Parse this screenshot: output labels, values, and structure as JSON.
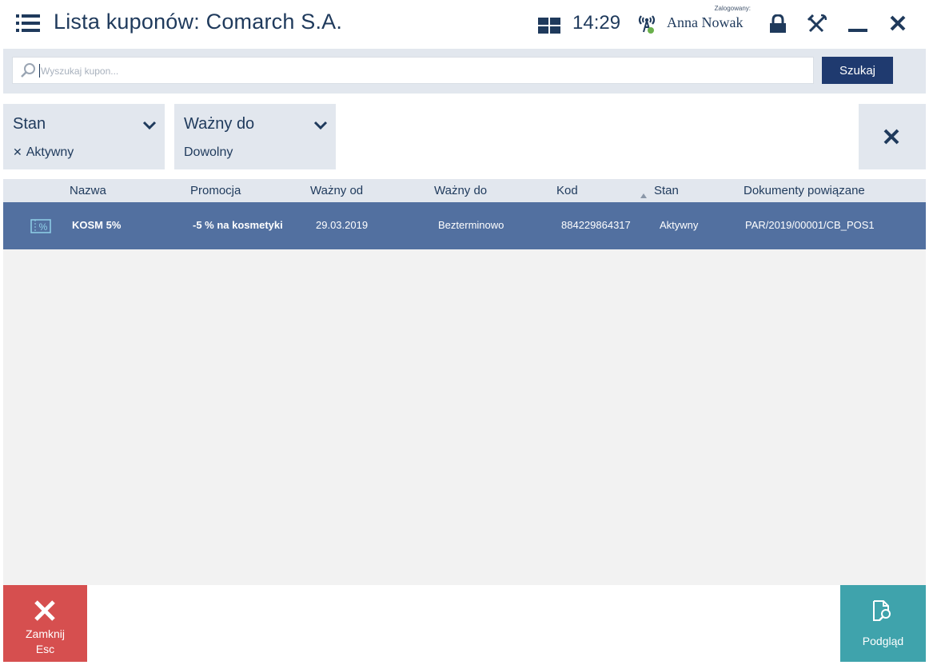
{
  "header": {
    "title": "Lista kuponów: Comarch S.A.",
    "clock": "14:29",
    "logged_in_label": "Zalogowany:",
    "user_name": "Anna Nowak"
  },
  "search": {
    "placeholder": "Wyszukaj kupon...",
    "value": "",
    "button_label": "Szukaj"
  },
  "filters": [
    {
      "title": "Stan",
      "value": "Aktywny",
      "has_remove": true
    },
    {
      "title": "Ważny do",
      "value": "Dowolny",
      "has_remove": false
    }
  ],
  "table": {
    "columns": [
      "Nazwa",
      "Promocja",
      "Ważny od",
      "Ważny do",
      "Kod",
      "Stan",
      "Dokumenty powiązane"
    ],
    "sorted_column": "Stan",
    "sort_direction": "asc",
    "rows": [
      {
        "icon": "coupon-percent-icon",
        "icon_text": "%",
        "nazwa": "KOSM 5%",
        "promocja": "-5 % na kosmetyki",
        "wazny_od": "29.03.2019",
        "wazny_do": "Bezterminowo",
        "kod": "884229864317",
        "stan": "Aktywny",
        "dokumenty": "PAR/2019/00001/CB_POS1",
        "selected": true
      }
    ]
  },
  "buttons": {
    "close_label": "Zamknij",
    "close_shortcut": "Esc",
    "preview_label": "Podgląd"
  },
  "colors": {
    "text": "#1f3a5c",
    "panel": "#e2e7ee",
    "selected_row": "#5270a0",
    "search_button": "#1f3a6f",
    "close_button": "#d64f4f",
    "preview_button": "#3fa3ac",
    "signal_dot": "#6ab04c"
  }
}
